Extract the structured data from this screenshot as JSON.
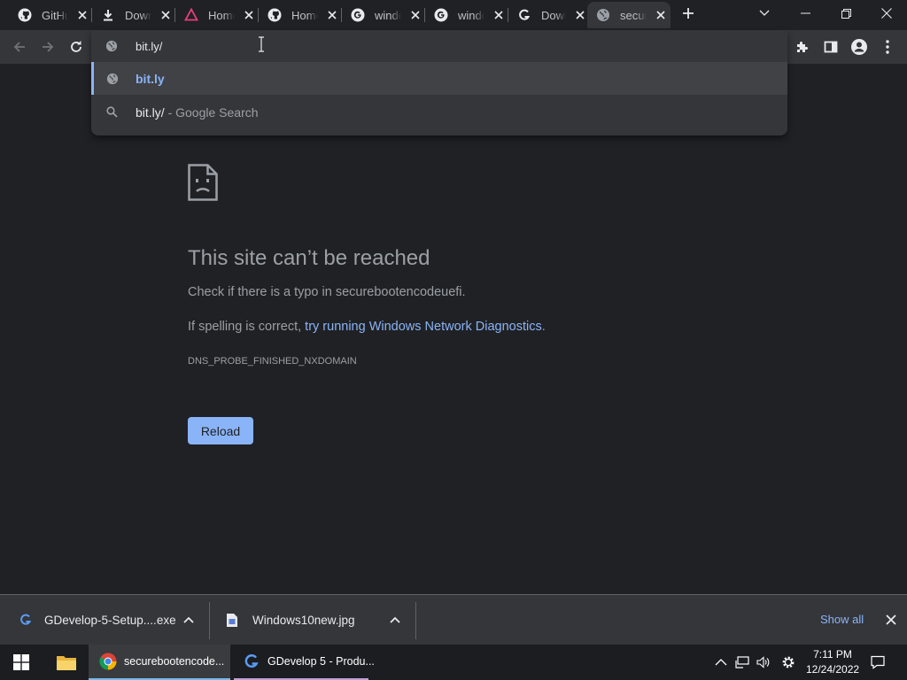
{
  "browser": {
    "tabs": [
      {
        "label": "GitHub",
        "icon": "github-icon"
      },
      {
        "label": "Downloads",
        "icon": "download-icon"
      },
      {
        "label": "Home",
        "icon": "affinity-icon"
      },
      {
        "label": "Home",
        "icon": "github-icon"
      },
      {
        "label": "windows",
        "icon": "google-icon"
      },
      {
        "label": "windows",
        "icon": "google-icon"
      },
      {
        "label": "Download",
        "icon": "gdevelop-icon"
      },
      {
        "label": "secure",
        "icon": "globe-icon",
        "active": true
      }
    ],
    "omnibox": {
      "value": "bit.ly/",
      "suggestions": [
        {
          "text": "bit.ly",
          "icon": "globe-icon",
          "selected": true
        },
        {
          "text": "bit.ly/",
          "suffix": " - Google Search",
          "icon": "search-icon"
        }
      ]
    }
  },
  "error_page": {
    "title": "This site can’t be reached",
    "check_text": "Check if there is a typo in securebootencodeuefi.",
    "spelling_prefix": "If spelling is correct, ",
    "diagnostics_link": "try running Windows Network Diagnostics",
    "spelling_suffix": ".",
    "error_code": "DNS_PROBE_FINISHED_NXDOMAIN",
    "reload_label": "Reload"
  },
  "downloads_bar": {
    "items": [
      {
        "name": "GDevelop-5-Setup....exe",
        "icon": "gdevelop-icon"
      },
      {
        "name": "Windows10new.jpg",
        "icon": "image-file-icon"
      }
    ],
    "show_all_label": "Show all"
  },
  "taskbar": {
    "items": [
      {
        "label": "securebootencode...",
        "icon": "chrome-icon",
        "active": true
      },
      {
        "label": "GDevelop 5 - Produ...",
        "icon": "gdevelop-icon"
      }
    ],
    "time": "7:11 PM",
    "date": "12/24/2022"
  },
  "colors": {
    "background": "#202124",
    "toolbar": "#35363a",
    "accent": "#8ab4f8",
    "muted_text": "#9aa0a6"
  }
}
